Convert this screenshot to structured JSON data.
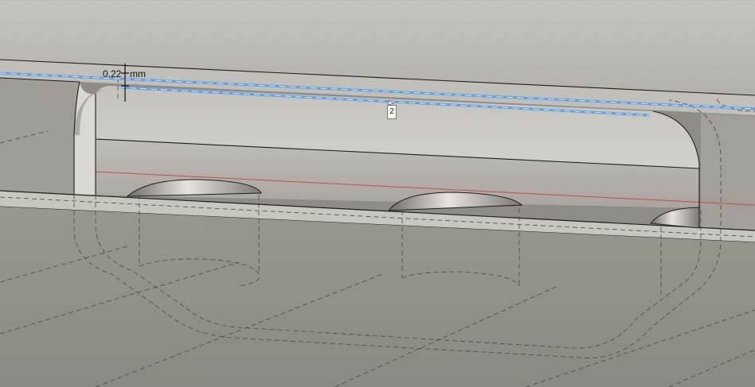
{
  "viewport": {
    "dimension": {
      "value": "0.22",
      "unit": "mm"
    },
    "edge_tag": "2",
    "colors": {
      "background": "#8f8c85",
      "surface": "#b9b7b0",
      "selection": "#5c9ee8",
      "axis_red": "#d44a3c"
    }
  }
}
